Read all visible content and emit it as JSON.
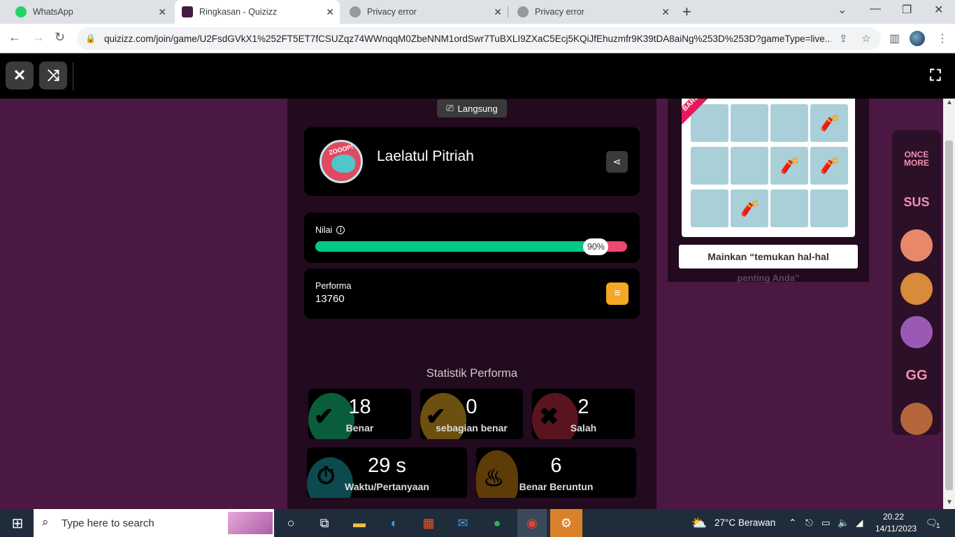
{
  "browser": {
    "tabs": [
      {
        "label": "WhatsApp",
        "color": "#25d366"
      },
      {
        "label": "Ringkasan - Quizizz",
        "color": "#461a42"
      },
      {
        "label": "Privacy error",
        "color": "#888888"
      },
      {
        "label": "Privacy error",
        "color": "#888888"
      }
    ],
    "url": "quizizz.com/join/game/U2FsdGVkX1%252FT5ET7fCSUZqz74WWnqqM0ZbeNNM1ordSwr7TuBXLI9ZXaC5Ecj5KQiJfEhuzmfr9K39tDA8aiNg%253D%253D?gameType=live..."
  },
  "summary": {
    "mode_badge": "Langsung",
    "player_name": "Laelatul Pitriah",
    "avatar_text": "ZOOOP!",
    "score_label": "Nilai",
    "score_percent": 90,
    "score_percent_text": "90%",
    "performance_label": "Performa",
    "performance_value": "13760"
  },
  "stats": {
    "title": "Statistik Performa",
    "correct": {
      "value": "18",
      "label": "Benar"
    },
    "partial": {
      "value": "0",
      "label": "sebagian benar"
    },
    "wrong": {
      "value": "2",
      "label": "Salah"
    },
    "time": {
      "value": "29 s",
      "label": "Waktu/Pertanyaan"
    },
    "streak": {
      "value": "6",
      "label": "Benar Beruntun"
    }
  },
  "promo": {
    "badge": "BARU",
    "button": "Mainkan “temukan hal-hal",
    "subtitle": "penting Anda”"
  },
  "stickers": [
    "ONCE MORE",
    "SUS",
    "sticker-face",
    "sticker-ok",
    "sticker-ghost",
    "GG",
    "sticker-sleep"
  ],
  "taskbar": {
    "search_placeholder": "Type here to search",
    "weather": "27°C  Berawan",
    "time": "20.22",
    "date": "14/11/2023",
    "notif_count": "1"
  }
}
